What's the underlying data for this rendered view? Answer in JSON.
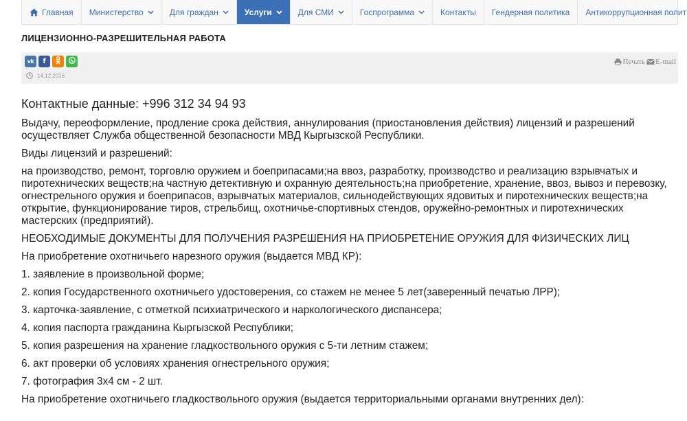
{
  "nav": {
    "items": [
      {
        "label": "Главная",
        "icon": "home-icon",
        "dropdown": false,
        "active": false
      },
      {
        "label": "Министерство",
        "dropdown": true,
        "active": false
      },
      {
        "label": "Для граждан",
        "dropdown": true,
        "active": false
      },
      {
        "label": "Услуги",
        "dropdown": true,
        "active": true
      },
      {
        "label": "Для СМИ",
        "dropdown": true,
        "active": false
      },
      {
        "label": "Госпрограмма",
        "dropdown": true,
        "active": false
      },
      {
        "label": "Контакты",
        "dropdown": false,
        "active": false
      },
      {
        "label": "Гендерная политика",
        "dropdown": false,
        "active": false
      },
      {
        "label": "Антикоррупционная политика",
        "dropdown": false,
        "active": false
      }
    ]
  },
  "article": {
    "title": "ЛИЦЕНЗИОННО-РАЗРЕШИТЕЛЬНАЯ РАБОТА",
    "date": "14.12.2016",
    "share": [
      {
        "network": "vk",
        "glyph": "vk"
      },
      {
        "network": "facebook",
        "glyph": "f"
      },
      {
        "network": "odnoklassniki",
        "glyph": "ok"
      },
      {
        "network": "whatsapp",
        "glyph": "whatsapp"
      }
    ],
    "print_label": "Печать",
    "email_label": "E-mail"
  },
  "body": {
    "contacts": "Контактные данные: +996 312 34 94 93",
    "intro": "Выдачу, переоформление, продление срока действия, аннулирования (приостановления действия) лицензий и разрешений осуществляет Служба общественной безопасности МВД Кыргызской Республики.",
    "types_heading": "Виды лицензий и разрешений:",
    "types_list": "на производство, ремонт, торговлю оружием и боеприпасами;на ввоз, разработку, производство и реализацию взрывчатых и пиротехнических веществ;на частную детективную и охранную деятельность;на приобретение, хранение, ввоз, вывоз и перевозку, огнестрельного оружия и боеприпасов, взрывчатых материалов, сильнодействующих ядовитых и пиротехнических веществ;на открытие, функционирование тиров, стрельбищ, охотничье-спортивных стендов, оружейно-ремонтных и пиротехнических мастерских (предприятий).",
    "docs_heading": "НЕОБХОДИМЫЕ ДОКУМЕНТЫ ДЛЯ ПОЛУЧЕНИЯ РАЗРЕШЕНИЯ НА ПРИОБРЕТЕНИЕ ОРУЖИЯ ДЛЯ ФИЗИЧЕСКИХ ЛИЦ",
    "rifled_heading": "На приобретение охотничьего нарезного оружия (выдается МВД КР):",
    "rifled_list": [
      "1. заявление в произвольной форме;",
      "2. копия Государственного охотничьего удостоверения, со стажем не менее 5 лет(заверенный печатью ЛРР);",
      "3. карточка-заявление, с отметкой психиатрического и наркологического диспансера;",
      "4. копия паспорта гражданина Кыргызской Республики;",
      "5. копия разрешения на хранение гладкоствольного оружия с 5-ти летним стажем;",
      "6. акт проверки об условиях хранения огнестрельного оружия;",
      "7. фотография 3х4 см - 2 шт."
    ],
    "smoothbore_heading": "На приобретение охотничьего гладкоствольного оружия (выдается территориальными органами внутренних дел):"
  },
  "colors": {
    "nav_link": "#3e6fa9",
    "nav_active_bg": "#3b6fb6",
    "meta_bg": "#f0f0f0"
  }
}
